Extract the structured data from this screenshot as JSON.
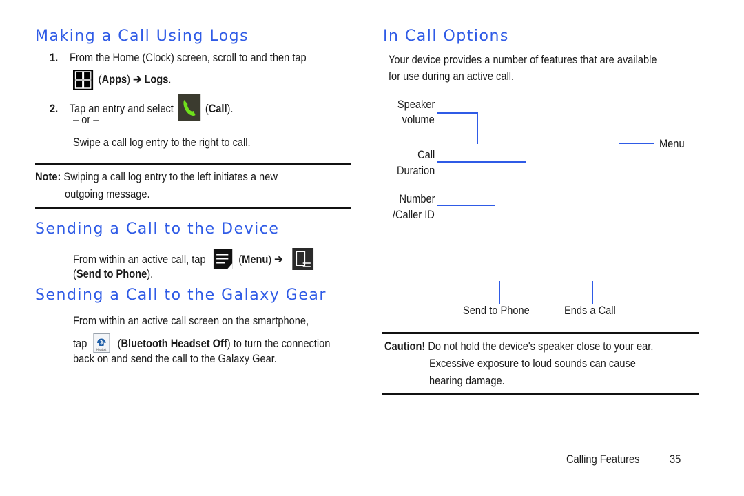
{
  "left_column": {
    "section1": {
      "title": "Making a Call Using Logs",
      "steps": [
        {
          "number": "1.",
          "text": "From the Home (Clock) screen, scroll to and then tap",
          "icon": "apps-grid-icon",
          "open_paren": "(",
          "bold1": "Apps",
          "close_paren": ")",
          "arrow": " ➔ ",
          "bold2": "Logs",
          "end": "."
        },
        {
          "number": "2.",
          "text": "Tap an entry and select",
          "icon": "phone-call-icon",
          "open_paren": "(",
          "bold1": "Call",
          "end": ")."
        }
      ],
      "or": "– or –",
      "alt_text": "Swipe a call log entry to the right to call."
    },
    "note": {
      "label": "Note:",
      "line1": "Swiping a call log entry to the left initiates a new",
      "line2": "outgoing message."
    },
    "section2": {
      "title": "Sending a Call to the Device",
      "text": "From within an active call, tap",
      "icon1": "menu-icon",
      "paren_open": "(",
      "bold1": "Menu",
      "paren_close": ")",
      "arrow": " ➔ ",
      "icon2": "send-to-phone-icon",
      "line2_open": "(",
      "line2_bold": "Send to Phone",
      "line2_end": ")."
    },
    "section3": {
      "title": "Sending a Call to the Galaxy Gear",
      "line1": "From within an active call screen on the smartphone,",
      "line2_start": "tap",
      "icon": "bluetooth-headset-icon",
      "icon_caption": "Headset",
      "paren_open": "(",
      "bold": "Bluetooth Headset Off",
      "line2_end": ") to turn the connection",
      "line3": "back on and send the call to the Galaxy Gear."
    }
  },
  "right_column": {
    "title": "In Call Options",
    "intro_line1": "Your device provides a number of features that are available",
    "intro_line2": "for use during an active call.",
    "callouts": {
      "speaker_volume": [
        "Speaker",
        "volume"
      ],
      "call_duration": [
        "Call",
        "Duration"
      ],
      "number_caller_id": [
        "Number",
        "/Caller ID"
      ],
      "menu": "Menu",
      "send_to_phone": "Send to Phone",
      "ends_a_call": "Ends a Call"
    },
    "caution": {
      "label": "Caution!",
      "line1": "Do not hold the device's speaker close to your ear.",
      "line2": "Excessive exposure to loud sounds can cause",
      "line3": "hearing damage."
    }
  },
  "footer": {
    "section": "Calling Features",
    "page": "35"
  },
  "colors": {
    "heading": "#2f5be6",
    "callout_line": "#2f5be6",
    "text": "#1a1a1a",
    "call_icon_green": "#6fe01c"
  }
}
